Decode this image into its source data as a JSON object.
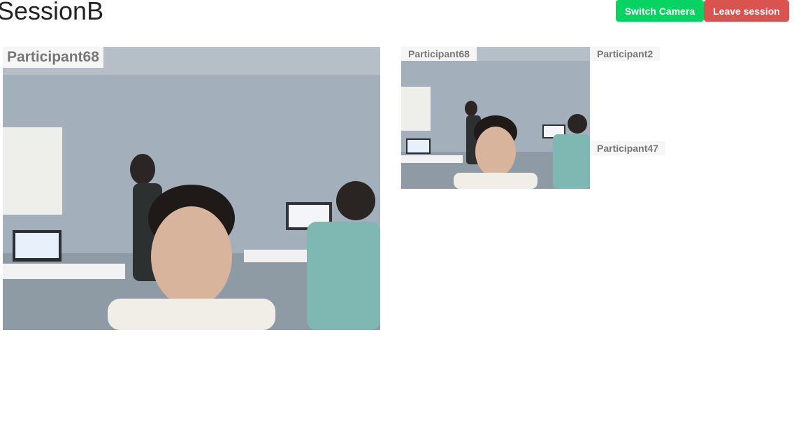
{
  "session": {
    "title": "SessionB"
  },
  "toolbar": {
    "switch_camera_label": "Switch Camera",
    "leave_session_label": "Leave session"
  },
  "main_video": {
    "participant": "Participant68"
  },
  "streams": [
    {
      "participant": "Participant68"
    },
    {
      "participant": "Participant2"
    },
    {
      "participant": "Participant47"
    }
  ],
  "colors": {
    "switch_button": "#06d362",
    "leave_button": "#d9534f",
    "name_tag_bg": "#f6f6f6"
  }
}
